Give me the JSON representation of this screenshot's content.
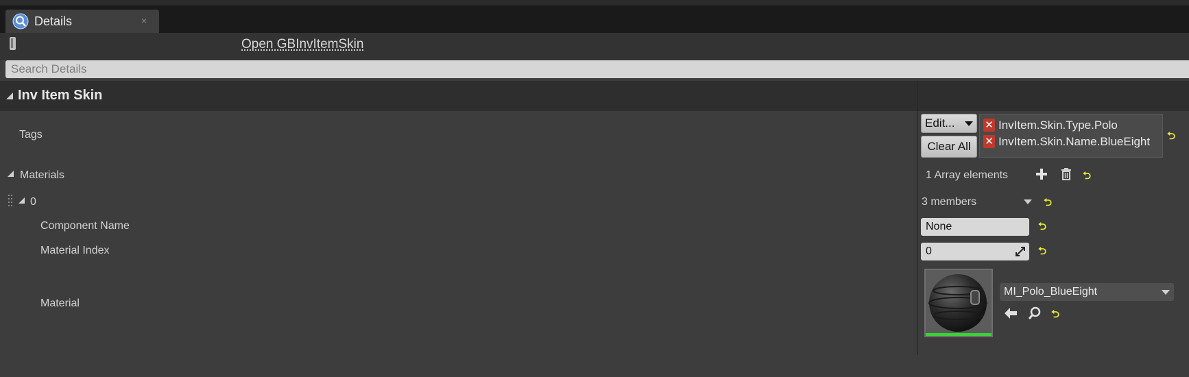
{
  "tab": {
    "label": "Details",
    "close": "×"
  },
  "toolbar": {
    "open_label": "Open GBInvItemSkin"
  },
  "search": {
    "placeholder": "Search Details"
  },
  "category": {
    "title": "Inv Item Skin"
  },
  "tags": {
    "label": "Tags",
    "edit_label": "Edit...",
    "clear_all_label": "Clear All",
    "items": [
      "InvItem.Skin.Type.Polo",
      "InvItem.Skin.Name.BlueEight"
    ]
  },
  "materials": {
    "label": "Materials",
    "array_count": "1 Array elements",
    "element": {
      "index": "0",
      "members": "3 members",
      "component_name": {
        "label": "Component Name",
        "value": "None"
      },
      "material_index": {
        "label": "Material Index",
        "value": "0"
      },
      "material": {
        "label": "Material",
        "value": "MI_Polo_BlueEight"
      }
    }
  },
  "colors": {
    "accent_reset": "#e8e831",
    "tag_remove": "#c0392b",
    "thumb_bar": "#3cd23c"
  },
  "icons": [
    "details-magnifier-icon",
    "lock-icon",
    "add-icon",
    "trash-icon",
    "reset-arrow-icon",
    "back-arrow-icon",
    "search-icon",
    "dropdown-icon",
    "remove-tag-icon",
    "spin-drag-icon"
  ]
}
